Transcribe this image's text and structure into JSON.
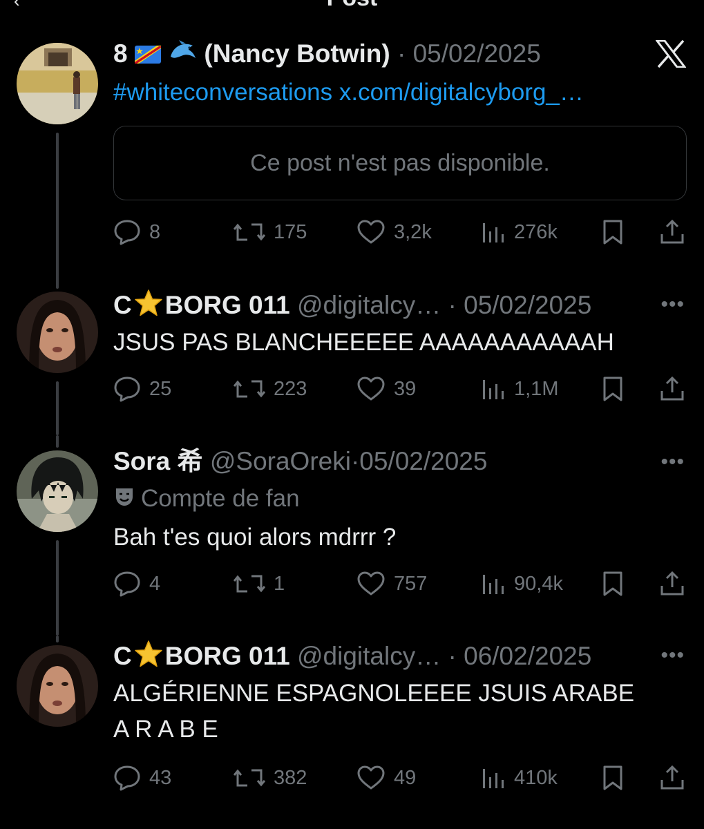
{
  "page": {
    "title": "Post"
  },
  "tweets": [
    {
      "name": "8",
      "name_suffix": "(Nancy Botwin)",
      "handle": "",
      "date": "05/02/2025",
      "hashtag": "#whiteconversations",
      "link": "x.com/digitalcyborg_…",
      "unavailable": "Ce post n'est pas disponible.",
      "replies": "8",
      "reposts": "175",
      "likes": "3,2k",
      "views": "276k"
    },
    {
      "name": "C",
      "name_suffix": "BORG 011",
      "handle": "@digitalcy…",
      "date": "05/02/2025",
      "text": "JSUS PAS BLANCHEEEEE AAAAAAAAAAAH",
      "replies": "25",
      "reposts": "223",
      "likes": "39",
      "views": "1,1M"
    },
    {
      "name": "Sora 希",
      "handle": "@SoraOreki",
      "date": "05/02/2025",
      "badge": "Compte de fan",
      "text": "Bah t'es quoi alors mdrrr ?",
      "replies": "4",
      "reposts": "1",
      "likes": "757",
      "views": "90,4k"
    },
    {
      "name": "C",
      "name_suffix": "BORG 011",
      "handle": "@digitalcy…",
      "date": "06/02/2025",
      "text_line1": "ALGÉRIENNE ESPAGNOLEEEE JSUIS ARABE",
      "text_line2": "A R A B E",
      "replies": "43",
      "reposts": "382",
      "likes": "49",
      "views": "410k"
    }
  ],
  "icons": {
    "reply": "reply-icon",
    "repost": "repost-icon",
    "like": "heart-icon",
    "views": "views-icon",
    "bookmark": "bookmark-icon",
    "share": "share-icon",
    "more": "more-icon",
    "x_logo": "x-logo-icon"
  },
  "colors": {
    "background": "#000000",
    "text": "#e7e9ea",
    "muted": "#71767b",
    "link": "#1d9bf0",
    "border": "#333639"
  }
}
